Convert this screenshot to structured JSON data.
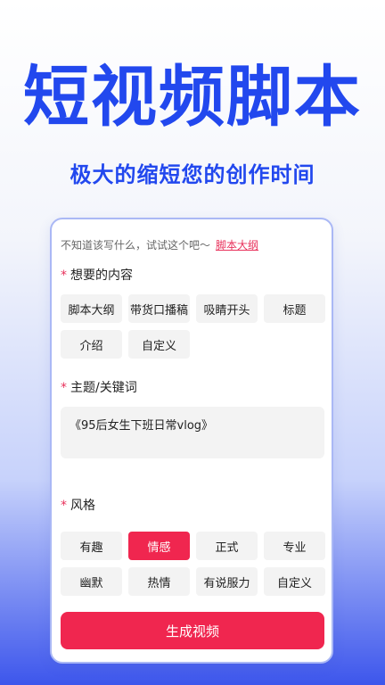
{
  "hero": {
    "title": "短视频脚本",
    "subtitle": "极大的缩短您的创作时间"
  },
  "hint": {
    "text": "不知道该写什么，试试这个吧～",
    "link": "脚本大纲"
  },
  "content_section": {
    "label": "想要的内容",
    "options": [
      "脚本大纲",
      "带货口播稿",
      "吸睛开头",
      "标题",
      "介绍",
      "自定义"
    ]
  },
  "topic_section": {
    "label": "主题/关键词",
    "value": "《95后女生下班日常vlog》"
  },
  "style_section": {
    "label": "风格",
    "options": [
      "有趣",
      "情感",
      "正式",
      "专业",
      "幽默",
      "热情",
      "有说服力",
      "自定义"
    ],
    "selected": "情感"
  },
  "required_mark": "*",
  "colors": {
    "brand_blue": "#2248ee",
    "accent_red": "#f0264f",
    "chip_bg": "#f3f3f3"
  },
  "actions": {
    "generate_label": "生成视频"
  }
}
